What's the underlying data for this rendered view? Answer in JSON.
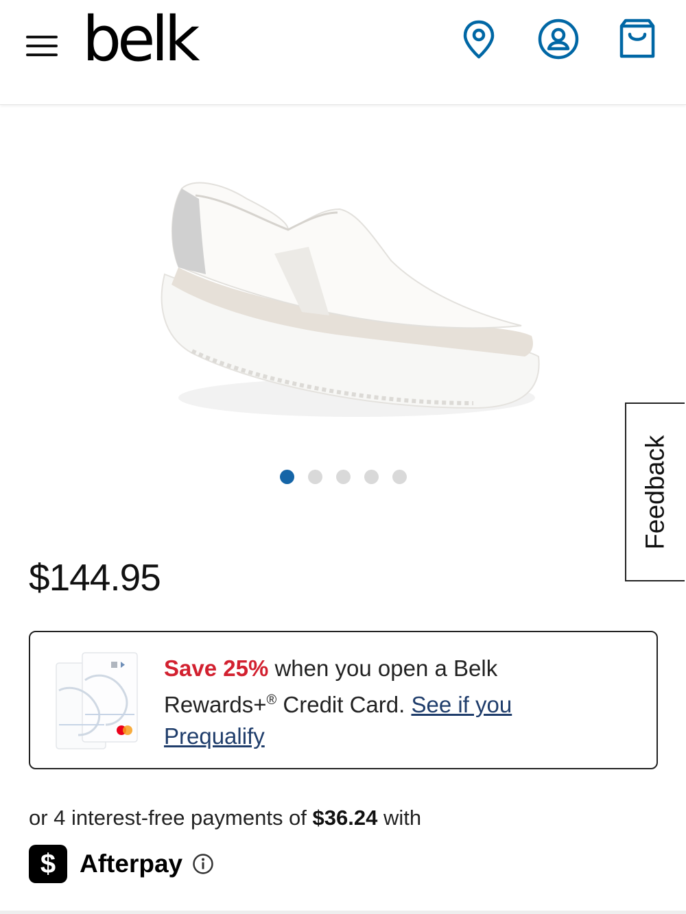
{
  "header": {
    "logo": "belk",
    "icons": [
      "menu-icon",
      "location-pin-icon",
      "account-icon",
      "shopping-bag-icon"
    ],
    "brand_color": "#0067a5"
  },
  "carousel": {
    "slide_count": 5,
    "active_index": 0
  },
  "feedback": {
    "label": "Feedback"
  },
  "product": {
    "price": "$144.95"
  },
  "promo": {
    "highlight": "Save 25%",
    "text_part1": " when you open a Belk Rewards+",
    "reg_mark": "®",
    "text_part2": " Credit Card.  ",
    "link": "See if you Prequalify"
  },
  "afterpay": {
    "prefix": "or 4 interest-free payments of ",
    "amount": "$36.24",
    "suffix": " with",
    "logo_symbol": "$",
    "name": "Afterpay"
  },
  "colors": {
    "promo_red": "#d2202f",
    "link_blue": "#1f3d6b",
    "dot_active": "#1565a7"
  }
}
